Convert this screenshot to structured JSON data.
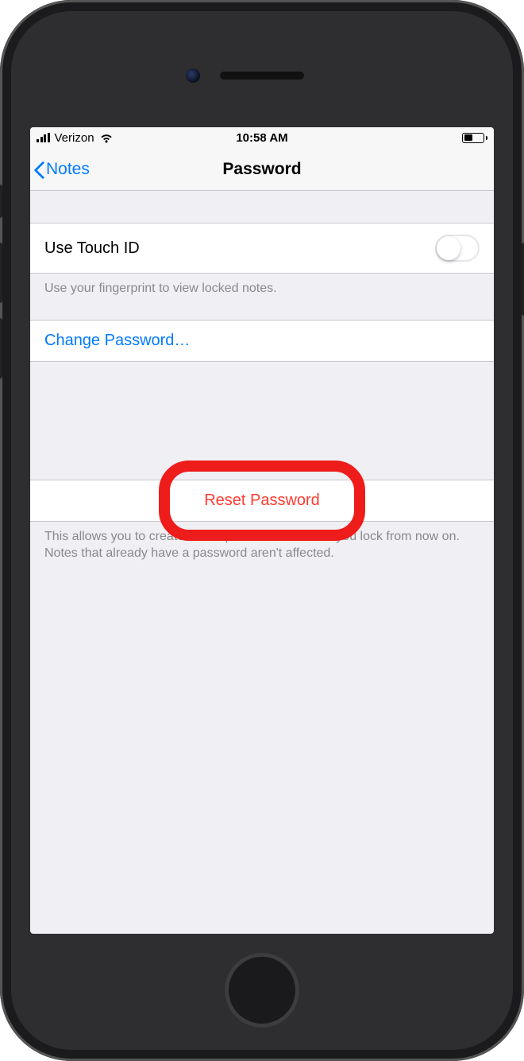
{
  "status": {
    "carrier": "Verizon",
    "time": "10:58 AM"
  },
  "nav": {
    "back_label": "Notes",
    "title": "Password"
  },
  "touch_id": {
    "label": "Use Touch ID",
    "footer": "Use your fingerprint to view locked notes."
  },
  "change_password": {
    "label": "Change Password…"
  },
  "reset_password": {
    "label": "Reset Password",
    "footer": "This allows you to create a new password for notes you lock from now on. Notes that already have a password aren't affected."
  }
}
